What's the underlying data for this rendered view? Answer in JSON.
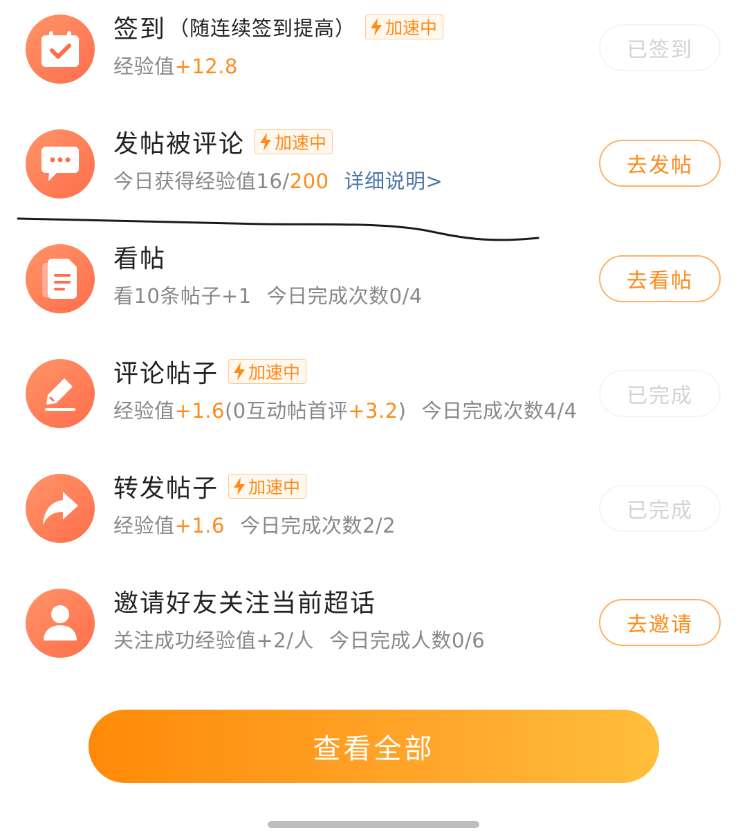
{
  "boost_label": "加速中",
  "colors": {
    "accent": "#ff8a1a",
    "icon_bg": "#ff7a55",
    "link": "#4a76a8"
  },
  "tasks": [
    {
      "icon": "calendar-check-icon",
      "title": "签到",
      "title_note": "（随连续签到提高）",
      "sub": {
        "prefix": "经验值",
        "highlight": "+12.8"
      },
      "button": "已签到"
    },
    {
      "icon": "chat-bubble-icon",
      "title": "发帖被评论",
      "sub": {
        "prefix": "今日获得经验值16/",
        "highlight": "200",
        "link": "详细说明>"
      },
      "button": "去发帖"
    },
    {
      "icon": "document-icon",
      "title": "看帖",
      "sub": {
        "text": "看10条帖子+1",
        "count": "今日完成次数0/4"
      },
      "button": "去看帖"
    },
    {
      "icon": "pencil-icon",
      "title": "评论帖子",
      "sub": {
        "prefix": "经验值",
        "highlight": "+1.6",
        "middle": "(0互动帖首评",
        "highlight2": "+3.2",
        "suffix": ")",
        "count": "今日完成次数4/4"
      },
      "button": "已完成"
    },
    {
      "icon": "share-arrow-icon",
      "title": "转发帖子",
      "sub": {
        "prefix": "经验值",
        "highlight": "+1.6",
        "count": "今日完成次数2/2"
      },
      "button": "已完成"
    },
    {
      "icon": "user-icon",
      "title": "邀请好友关注当前超话",
      "sub": {
        "text": "关注成功经验值+2/人",
        "count": "今日完成人数0/6"
      },
      "button": "去邀请"
    }
  ],
  "view_all_button": "查看全部"
}
